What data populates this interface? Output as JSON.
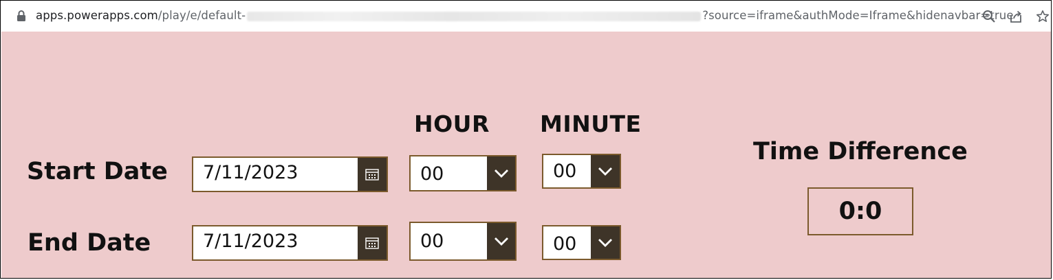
{
  "browser": {
    "url_host": "apps.powerapps.com",
    "url_path": "/play/e/default-",
    "url_query": "?source=iframe&authMode=Iframe&hidenavbar=true"
  },
  "app": {
    "headers": {
      "hour": "HOUR",
      "minute": "MINUTE"
    },
    "start": {
      "label": "Start Date",
      "date": "7/11/2023",
      "hour": "00",
      "minute": "00"
    },
    "end": {
      "label": "End Date",
      "date": "7/11/2023",
      "hour": "00",
      "minute": "00"
    },
    "result": {
      "title": "Time Difference",
      "value": "0:0"
    }
  },
  "colors": {
    "background": "#eecbcc",
    "border": "#7b5a2c",
    "button": "#3e3428"
  }
}
